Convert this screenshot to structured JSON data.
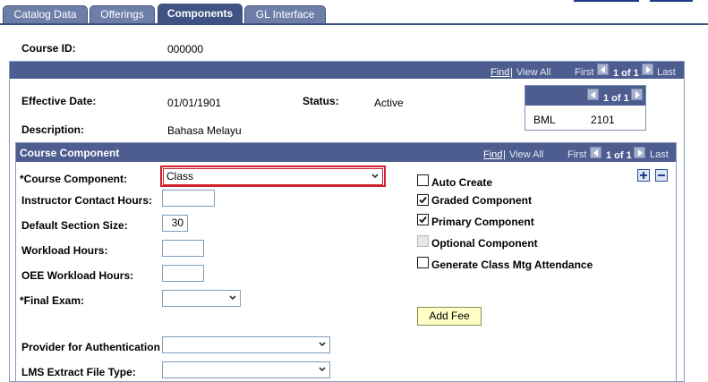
{
  "tabs": [
    {
      "label": "Catalog Data",
      "active": false
    },
    {
      "label": "Offerings",
      "active": false
    },
    {
      "label": "Components",
      "active": true
    },
    {
      "label": "GL Interface",
      "active": false
    }
  ],
  "course_id": {
    "label": "Course ID:",
    "value": "000000"
  },
  "outer_nav": {
    "find": "Find",
    "view_all": "View All",
    "first": "First",
    "count": "1 of 1",
    "last": "Last"
  },
  "effective_date": {
    "label": "Effective Date:",
    "value": "01/01/1901"
  },
  "status": {
    "label": "Status:",
    "value": "Active"
  },
  "description": {
    "label": "Description:",
    "value": "Bahasa Melayu"
  },
  "mini_panel": {
    "count": "1 of 1",
    "code": "BML",
    "value": "2101"
  },
  "component_section": {
    "title": "Course Component",
    "nav": {
      "find": "Find",
      "view_all": "View All",
      "first": "First",
      "count": "1 of 1",
      "last": "Last"
    }
  },
  "fields": {
    "course_component": {
      "label": "*Course Component:",
      "value": "Class"
    },
    "instructor_contact_hours": {
      "label": "Instructor Contact Hours:",
      "value": ""
    },
    "default_section_size": {
      "label": "Default Section Size:",
      "value": "30"
    },
    "workload_hours": {
      "label": "Workload Hours:",
      "value": ""
    },
    "oee_workload_hours": {
      "label": "OEE Workload Hours:",
      "value": ""
    },
    "final_exam": {
      "label": "*Final Exam:",
      "value": ""
    },
    "provider_for_authentication": {
      "label": "Provider for Authentication",
      "value": ""
    },
    "lms_extract_file_type": {
      "label": "LMS Extract File Type:",
      "value": ""
    }
  },
  "checkboxes": [
    {
      "label": "Auto Create",
      "checked": false,
      "disabled": false
    },
    {
      "label": "Graded Component",
      "checked": true,
      "disabled": false
    },
    {
      "label": "Primary Component",
      "checked": true,
      "disabled": false
    },
    {
      "label": "Optional Component",
      "checked": false,
      "disabled": true
    },
    {
      "label": "Generate Class Mtg Attendance",
      "checked": false,
      "disabled": false
    }
  ],
  "add_fee_button": "Add Fee",
  "colors": {
    "bar": "#4d5d8f",
    "tab": "#6d7fa8",
    "tab_active": "#3e5284",
    "highlight_border": "#d0202a",
    "button_bg": "#ffffc6"
  },
  "icons": {
    "add_row": "plus-icon",
    "delete_row": "minus-icon",
    "prev": "arrow-left-icon",
    "next": "arrow-right-icon",
    "dropdown": "chevron-down-icon",
    "checked": "checkmark-icon"
  }
}
